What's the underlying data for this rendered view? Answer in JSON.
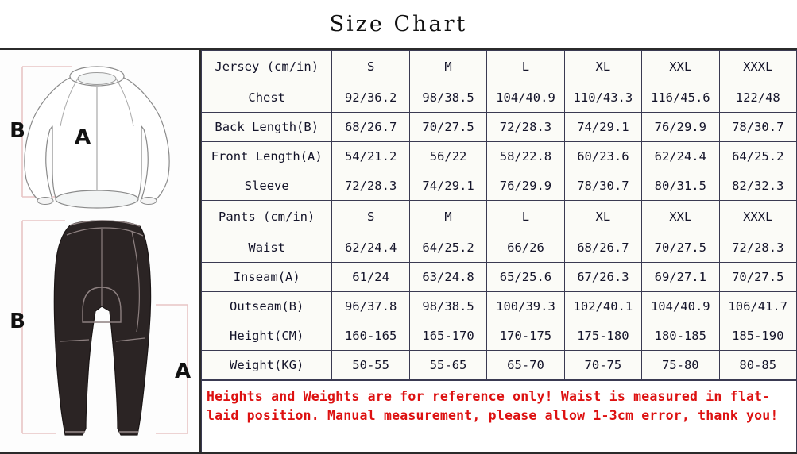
{
  "title": "Size Chart",
  "illustrations": {
    "jersey": {
      "name": "jersey-diagram",
      "label_back_length": "B",
      "label_front_length": "A"
    },
    "pants": {
      "name": "pants-diagram",
      "label_outseam": "B",
      "label_inseam": "A"
    }
  },
  "table": {
    "jersey_header": [
      "Jersey (cm/in)",
      "S",
      "M",
      "L",
      "XL",
      "XXL",
      "XXXL"
    ],
    "jersey_rows": [
      {
        "label": "Chest",
        "values": [
          "92/36.2",
          "98/38.5",
          "104/40.9",
          "110/43.3",
          "116/45.6",
          "122/48"
        ]
      },
      {
        "label": "Back Length(B)",
        "values": [
          "68/26.7",
          "70/27.5",
          "72/28.3",
          "74/29.1",
          "76/29.9",
          "78/30.7"
        ]
      },
      {
        "label": "Front Length(A)",
        "values": [
          "54/21.2",
          "56/22",
          "58/22.8",
          "60/23.6",
          "62/24.4",
          "64/25.2"
        ]
      },
      {
        "label": "Sleeve",
        "values": [
          "72/28.3",
          "74/29.1",
          "76/29.9",
          "78/30.7",
          "80/31.5",
          "82/32.3"
        ]
      }
    ],
    "pants_header": [
      "Pants (cm/in)",
      "S",
      "M",
      "L",
      "XL",
      "XXL",
      "XXXL"
    ],
    "pants_rows": [
      {
        "label": "Waist",
        "values": [
          "62/24.4",
          "64/25.2",
          "66/26",
          "68/26.7",
          "70/27.5",
          "72/28.3"
        ],
        "tinted": false
      },
      {
        "label": "Inseam(A)",
        "values": [
          "61/24",
          "63/24.8",
          "65/25.6",
          "67/26.3",
          "69/27.1",
          "70/27.5"
        ],
        "tinted": false
      },
      {
        "label": "Outseam(B)",
        "values": [
          "96/37.8",
          "98/38.5",
          "100/39.3",
          "102/40.1",
          "104/40.9",
          "106/41.7"
        ],
        "tinted": false
      },
      {
        "label": "Height(CM)",
        "values": [
          "160-165",
          "165-170",
          "170-175",
          "175-180",
          "180-185",
          "185-190"
        ],
        "tinted": true
      },
      {
        "label": "Weight(KG)",
        "values": [
          "50-55",
          "55-65",
          "65-70",
          "70-75",
          "75-80",
          "80-85"
        ],
        "tinted": true
      }
    ]
  },
  "note": {
    "text": "Heights and Weights are for reference only! Waist is measured in flat-laid position. Manual measurement, please allow 1-3cm error, thank you!",
    "color": "#dd1111"
  }
}
